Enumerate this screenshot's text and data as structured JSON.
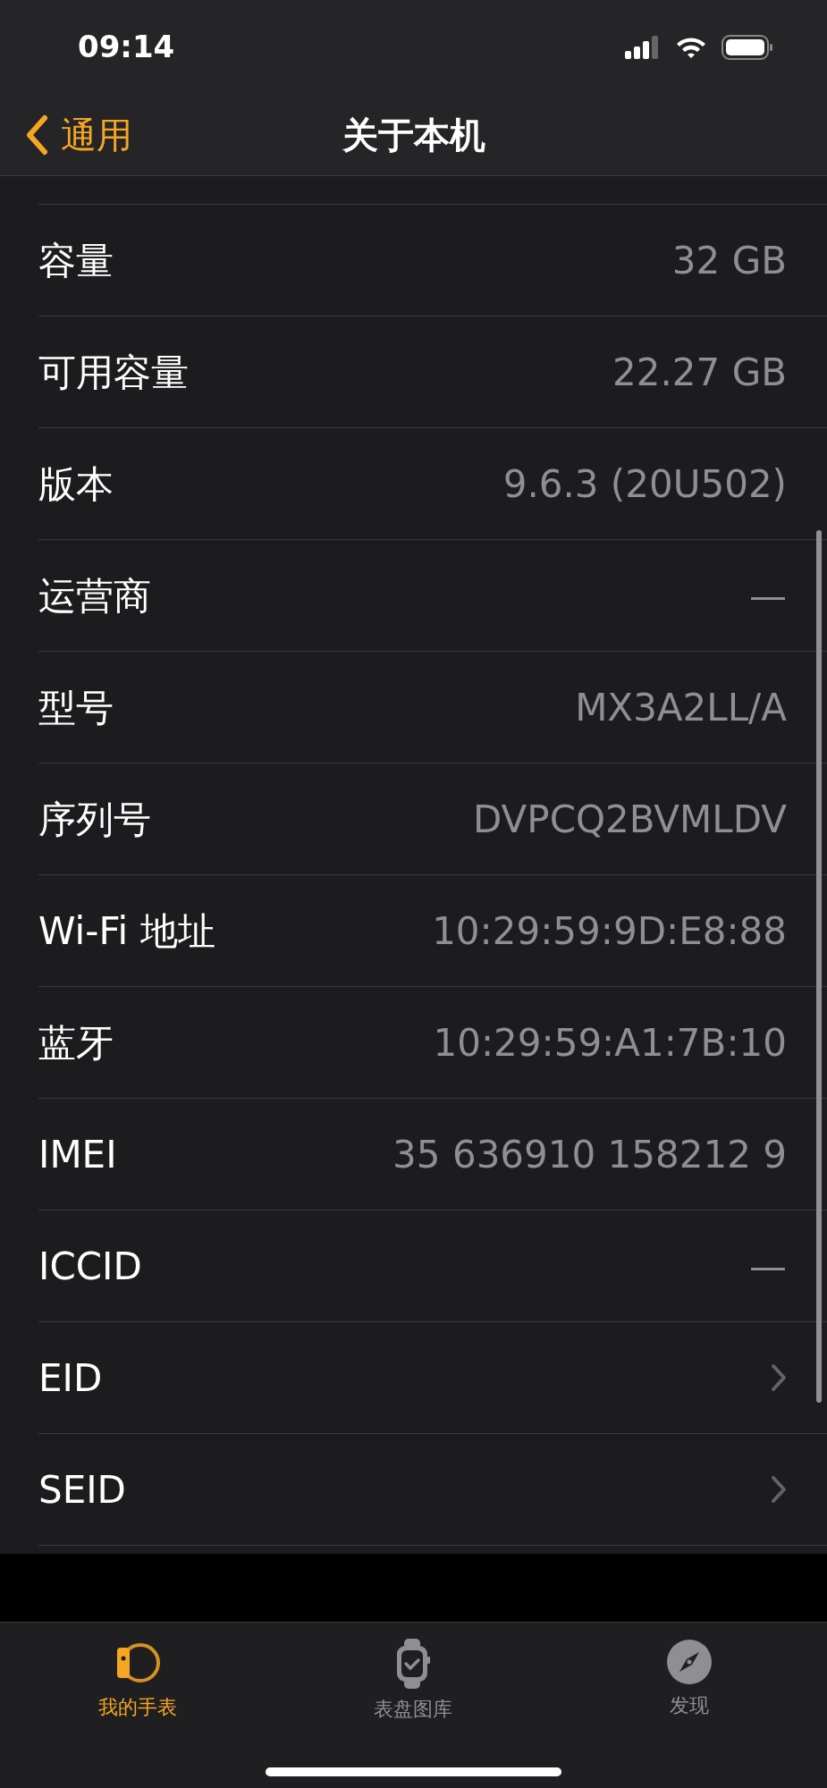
{
  "status_bar": {
    "time": "09:14"
  },
  "nav": {
    "back": "通用",
    "title": "关于本机"
  },
  "rows": [
    {
      "kind": "value",
      "label": "容量",
      "value": "32 GB"
    },
    {
      "kind": "value",
      "label": "可用容量",
      "value": "22.27 GB"
    },
    {
      "kind": "value",
      "label": "版本",
      "value": "9.6.3 (20U502)"
    },
    {
      "kind": "value",
      "label": "运营商",
      "value": "—"
    },
    {
      "kind": "value",
      "label": "型号",
      "value": "MX3A2LL/A"
    },
    {
      "kind": "value",
      "label": "序列号",
      "value": "DVPCQ2BVMLDV"
    },
    {
      "kind": "value",
      "label": "Wi-Fi 地址",
      "value": "10:29:59:9D:E8:88"
    },
    {
      "kind": "value",
      "label": "蓝牙",
      "value": "10:29:59:A1:7B:10"
    },
    {
      "kind": "value",
      "label": "IMEI",
      "value": "35 636910 158212 9"
    },
    {
      "kind": "value",
      "label": "ICCID",
      "value": "—"
    },
    {
      "kind": "disclosure",
      "label": "EID"
    },
    {
      "kind": "disclosure",
      "label": "SEID"
    }
  ],
  "tabs": [
    {
      "kind": "my-watch",
      "label": "我的手表",
      "selected": true
    },
    {
      "kind": "face-gallery",
      "label": "表盘图库",
      "selected": false
    },
    {
      "kind": "discover",
      "label": "发现",
      "selected": false
    }
  ]
}
